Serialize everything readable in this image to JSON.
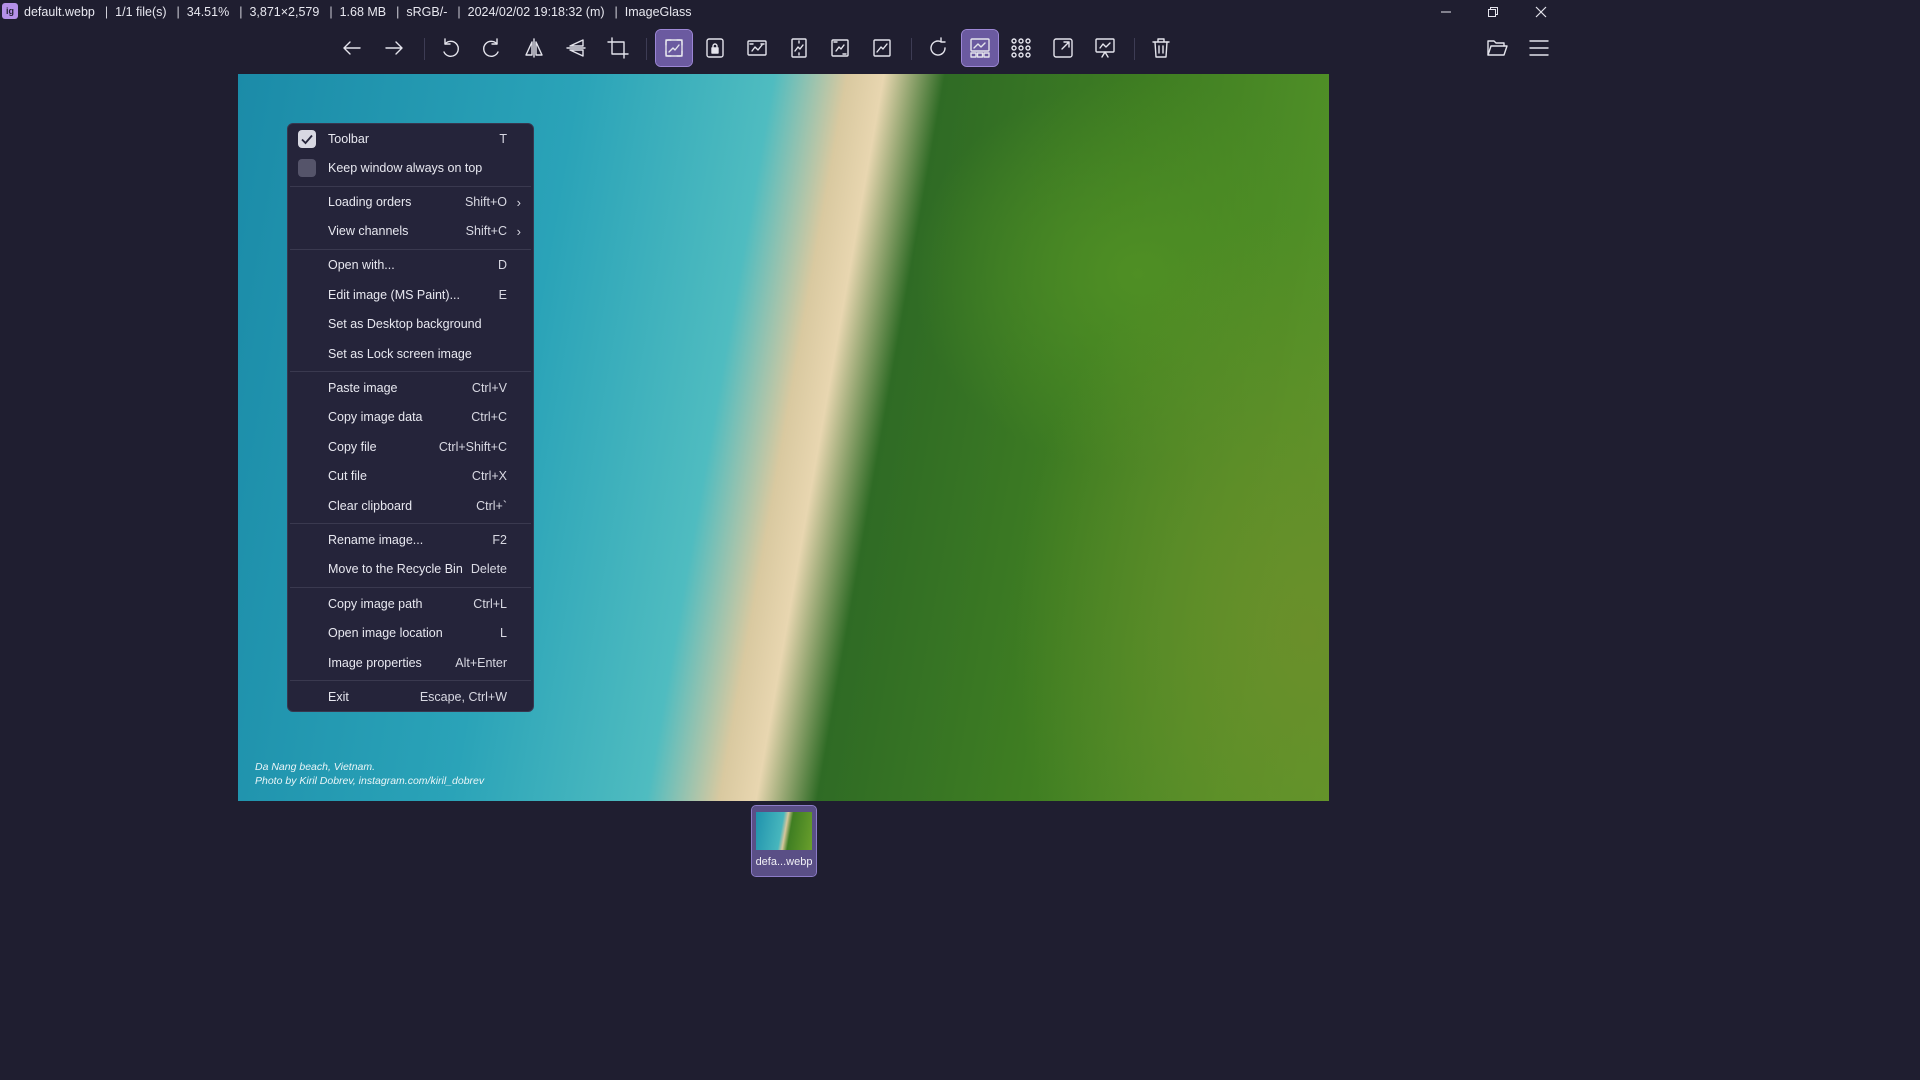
{
  "titlebar": {
    "app_logo": "ig",
    "filename": "default.webp",
    "file_count": "1/1 file(s)",
    "zoom": "34.51%",
    "dimensions": "3,871×2,579",
    "file_size": "1.68 MB",
    "color_profile": "sRGB/-",
    "date_taken": "2024/02/02 19:18:32 (m)",
    "app_name": "ImageGlass",
    "window_buttons": [
      "minimize-icon",
      "restore-icon",
      "close-icon"
    ]
  },
  "toolbar": {
    "buttons": [
      {
        "icon": "arrow-left-icon",
        "tooltip": "Previous image",
        "active": false
      },
      {
        "icon": "arrow-right-icon",
        "tooltip": "Next image",
        "active": false
      },
      {
        "icon": "rotate-left-icon",
        "tooltip": "Rotate left",
        "active": false
      },
      {
        "icon": "rotate-right-icon",
        "tooltip": "Rotate right",
        "active": false
      },
      {
        "icon": "flip-horizontal-icon",
        "tooltip": "Flip horizontal",
        "active": false
      },
      {
        "icon": "flip-vertical-icon",
        "tooltip": "Flip vertical",
        "active": false
      },
      {
        "icon": "crop-icon",
        "tooltip": "Crop",
        "active": false
      },
      {
        "icon": "auto-zoom-icon",
        "tooltip": "Auto zoom",
        "active": true
      },
      {
        "icon": "lock-zoom-icon",
        "tooltip": "Lock zoom",
        "active": false
      },
      {
        "icon": "scale-to-width-icon",
        "tooltip": "Scale to width",
        "active": false
      },
      {
        "icon": "scale-to-height-icon",
        "tooltip": "Scale to height",
        "active": false
      },
      {
        "icon": "scale-to-fit-icon",
        "tooltip": "Scale to fit",
        "active": false
      },
      {
        "icon": "scale-to-fill-icon",
        "tooltip": "Scale to fill",
        "active": false
      },
      {
        "icon": "refresh-icon",
        "tooltip": "Refresh",
        "active": false
      },
      {
        "icon": "gallery-icon",
        "tooltip": "Gallery",
        "active": true
      },
      {
        "icon": "grid-icon",
        "tooltip": "Checkerboard",
        "active": false
      },
      {
        "icon": "fullscreen-icon",
        "tooltip": "Full screen",
        "active": false
      },
      {
        "icon": "slideshow-icon",
        "tooltip": "Slideshow",
        "active": false
      },
      {
        "icon": "trash-icon",
        "tooltip": "Delete",
        "active": false
      },
      {
        "icon": "folder-open-icon",
        "tooltip": "Open file",
        "active": false
      },
      {
        "icon": "hamburger-menu-icon",
        "tooltip": "Main menu",
        "active": false
      }
    ]
  },
  "image": {
    "caption_line1": "Da Nang beach, Vietnam.",
    "caption_line2": "Photo by Kiril Dobrev, instagram.com/kiril_dobrev"
  },
  "context_menu": {
    "items": [
      {
        "label": "Toolbar",
        "shortcut": "T",
        "checkbox": "checked"
      },
      {
        "label": "Keep window always on top",
        "shortcut": "",
        "checkbox": "unchecked"
      },
      {
        "label": "Loading orders",
        "shortcut": "Shift+O",
        "submenu": true
      },
      {
        "label": "View channels",
        "shortcut": "Shift+C",
        "submenu": true
      },
      {
        "label": "Open with...",
        "shortcut": "D"
      },
      {
        "label": "Edit image (MS Paint)...",
        "shortcut": "E"
      },
      {
        "label": "Set as Desktop background",
        "shortcut": ""
      },
      {
        "label": "Set as Lock screen image",
        "shortcut": ""
      },
      {
        "label": "Paste image",
        "shortcut": "Ctrl+V"
      },
      {
        "label": "Copy image data",
        "shortcut": "Ctrl+C"
      },
      {
        "label": "Copy file",
        "shortcut": "Ctrl+Shift+C"
      },
      {
        "label": "Cut file",
        "shortcut": "Ctrl+X"
      },
      {
        "label": "Clear clipboard",
        "shortcut": "Ctrl+`"
      },
      {
        "label": "Rename image...",
        "shortcut": "F2"
      },
      {
        "label": "Move to the Recycle Bin",
        "shortcut": "Delete"
      },
      {
        "label": "Copy image path",
        "shortcut": "Ctrl+L"
      },
      {
        "label": "Open image location",
        "shortcut": "L"
      },
      {
        "label": "Image properties",
        "shortcut": "Alt+Enter"
      },
      {
        "label": "Exit",
        "shortcut": "Escape, Ctrl+W"
      }
    ]
  },
  "gallery": {
    "thumbnails": [
      {
        "label": "defa...webp",
        "selected": true
      }
    ]
  },
  "colors": {
    "background": "#1f1e30",
    "accent": "#6b5aa0",
    "menu_background": "#25243a",
    "text": "#e8e8f0"
  }
}
